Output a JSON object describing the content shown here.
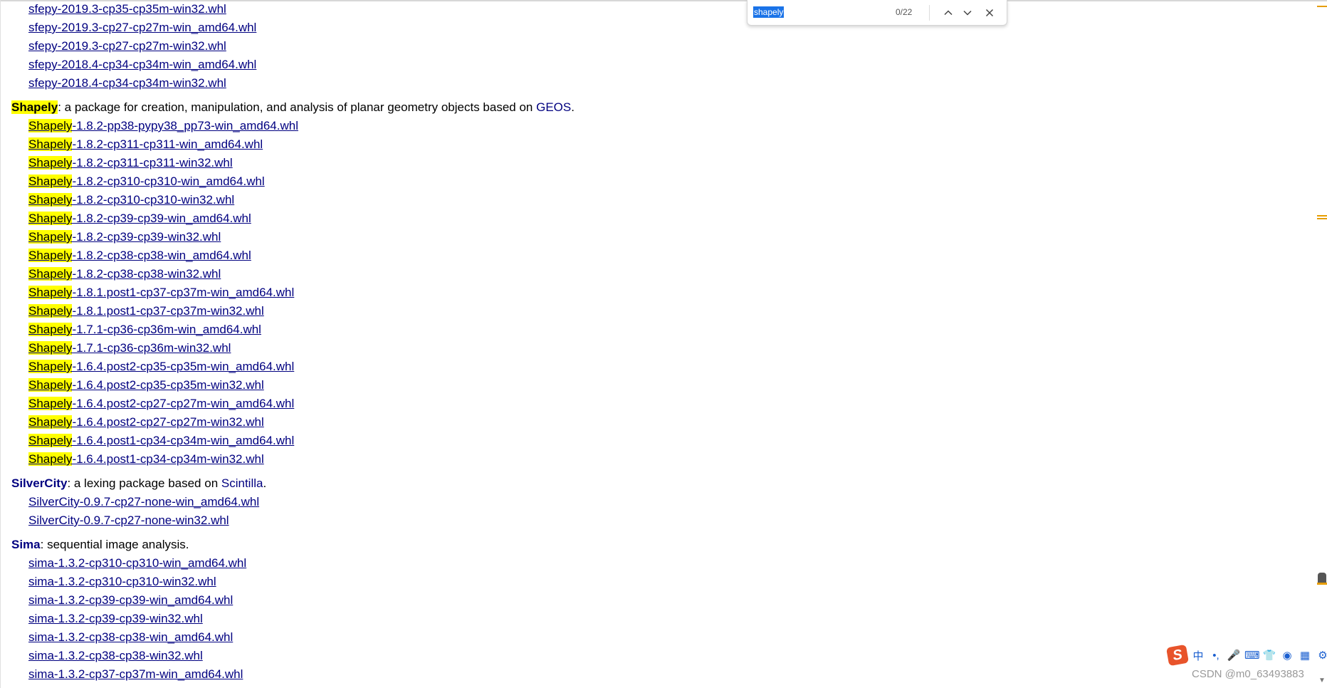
{
  "find_bar": {
    "query": "shapely",
    "count": "0/22"
  },
  "sfepy": {
    "files": [
      "sfepy-2019.3-cp35-cp35m-win32.whl",
      "sfepy-2019.3-cp27-cp27m-win_amd64.whl",
      "sfepy-2019.3-cp27-cp27m-win32.whl",
      "sfepy-2018.4-cp34-cp34m-win_amd64.whl",
      "sfepy-2018.4-cp34-cp34m-win32.whl"
    ]
  },
  "shapely": {
    "name": "Shapely",
    "desc": ": a package for creation, manipulation, and analysis of planar geometry objects based on ",
    "link": "GEOS",
    "end": ".",
    "files": [
      {
        "hl": "Shapely",
        "rest": "-1.8.2-pp38-pypy38_pp73-win_amd64.whl"
      },
      {
        "hl": "Shapely",
        "rest": "-1.8.2-cp311-cp311-win_amd64.whl"
      },
      {
        "hl": "Shapely",
        "rest": "-1.8.2-cp311-cp311-win32.whl"
      },
      {
        "hl": "Shapely",
        "rest": "-1.8.2-cp310-cp310-win_amd64.whl"
      },
      {
        "hl": "Shapely",
        "rest": "-1.8.2-cp310-cp310-win32.whl"
      },
      {
        "hl": "Shapely",
        "rest": "-1.8.2-cp39-cp39-win_amd64.whl"
      },
      {
        "hl": "Shapely",
        "rest": "-1.8.2-cp39-cp39-win32.whl"
      },
      {
        "hl": "Shapely",
        "rest": "-1.8.2-cp38-cp38-win_amd64.whl"
      },
      {
        "hl": "Shapely",
        "rest": "-1.8.2-cp38-cp38-win32.whl"
      },
      {
        "hl": "Shapely",
        "rest": "-1.8.1.post1-cp37-cp37m-win_amd64.whl"
      },
      {
        "hl": "Shapely",
        "rest": "-1.8.1.post1-cp37-cp37m-win32.whl"
      },
      {
        "hl": "Shapely",
        "rest": "-1.7.1-cp36-cp36m-win_amd64.whl"
      },
      {
        "hl": "Shapely",
        "rest": "-1.7.1-cp36-cp36m-win32.whl"
      },
      {
        "hl": "Shapely",
        "rest": "-1.6.4.post2-cp35-cp35m-win_amd64.whl"
      },
      {
        "hl": "Shapely",
        "rest": "-1.6.4.post2-cp35-cp35m-win32.whl"
      },
      {
        "hl": "Shapely",
        "rest": "-1.6.4.post2-cp27-cp27m-win_amd64.whl"
      },
      {
        "hl": "Shapely",
        "rest": "-1.6.4.post2-cp27-cp27m-win32.whl"
      },
      {
        "hl": "Shapely",
        "rest": "-1.6.4.post1-cp34-cp34m-win_amd64.whl"
      },
      {
        "hl": "Shapely",
        "rest": "-1.6.4.post1-cp34-cp34m-win32.whl"
      }
    ]
  },
  "silvercity": {
    "name": "SilverCity",
    "desc": ": a lexing package based on ",
    "link": "Scintilla",
    "end": ".",
    "files": [
      "SilverCity-0.9.7-cp27-none-win_amd64.whl",
      "SilverCity-0.9.7-cp27-none-win32.whl"
    ]
  },
  "sima": {
    "name": "Sima",
    "desc": ": sequential image analysis.",
    "files": [
      "sima-1.3.2-cp310-cp310-win_amd64.whl",
      "sima-1.3.2-cp310-cp310-win32.whl",
      "sima-1.3.2-cp39-cp39-win_amd64.whl",
      "sima-1.3.2-cp39-cp39-win32.whl",
      "sima-1.3.2-cp38-cp38-win_amd64.whl",
      "sima-1.3.2-cp38-cp38-win32.whl",
      "sima-1.3.2-cp37-cp37m-win_amd64.whl"
    ]
  },
  "ime": {
    "logo": "S",
    "chars": [
      "中",
      "•,",
      "🎤",
      "⌨",
      "👕",
      "◉",
      "▦",
      "⚙"
    ]
  },
  "watermark": "CSDN @m0_63493883"
}
